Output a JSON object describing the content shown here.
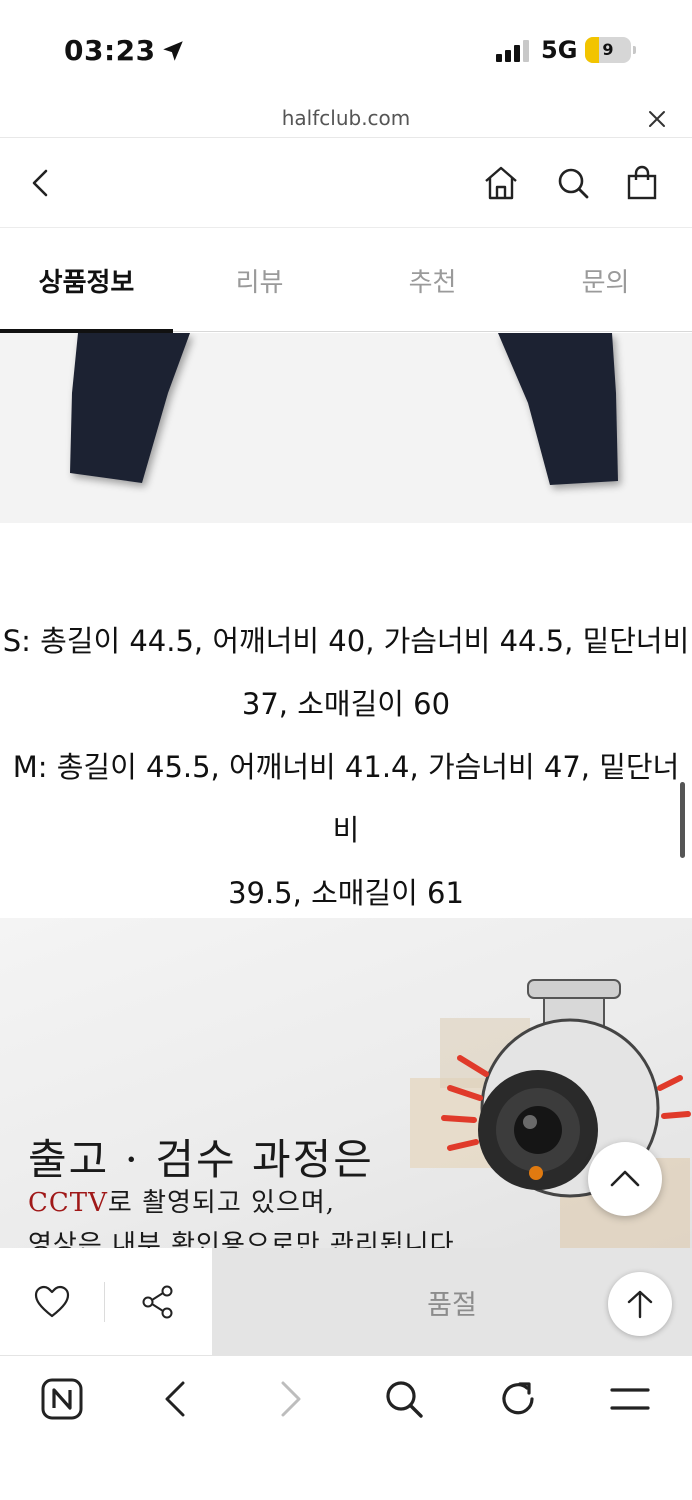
{
  "status_bar": {
    "time": "03:23",
    "network": "5G",
    "battery": "9"
  },
  "url_bar": {
    "url": "halfclub.com"
  },
  "tabs": [
    {
      "label": "상품정보",
      "active": true
    },
    {
      "label": "리뷰",
      "active": false
    },
    {
      "label": "추천",
      "active": false
    },
    {
      "label": "문의",
      "active": false
    }
  ],
  "size_info": {
    "line1": "S: 총길이 44.5, 어깨너비 40, 가슴너비 44.5, 밑단너비",
    "line2": "37, 소매길이 60",
    "line3": "M: 총길이 45.5, 어깨너비 41.4, 가슴너비 47, 밑단너비",
    "line4": "39.5, 소매길이 61"
  },
  "banner": {
    "title": "출고 · 검수 과정은",
    "line2_red": "CCTV",
    "line2_rest": "로 촬영되고 있으며,",
    "line3": "영상은 내부 확인용으로만 관리됩니다"
  },
  "action_bar": {
    "soldout_label": "품절"
  },
  "colors": {
    "accent_red": "#a01818",
    "soldout_bg": "#e4e4e4",
    "tab_active": "#111111"
  }
}
